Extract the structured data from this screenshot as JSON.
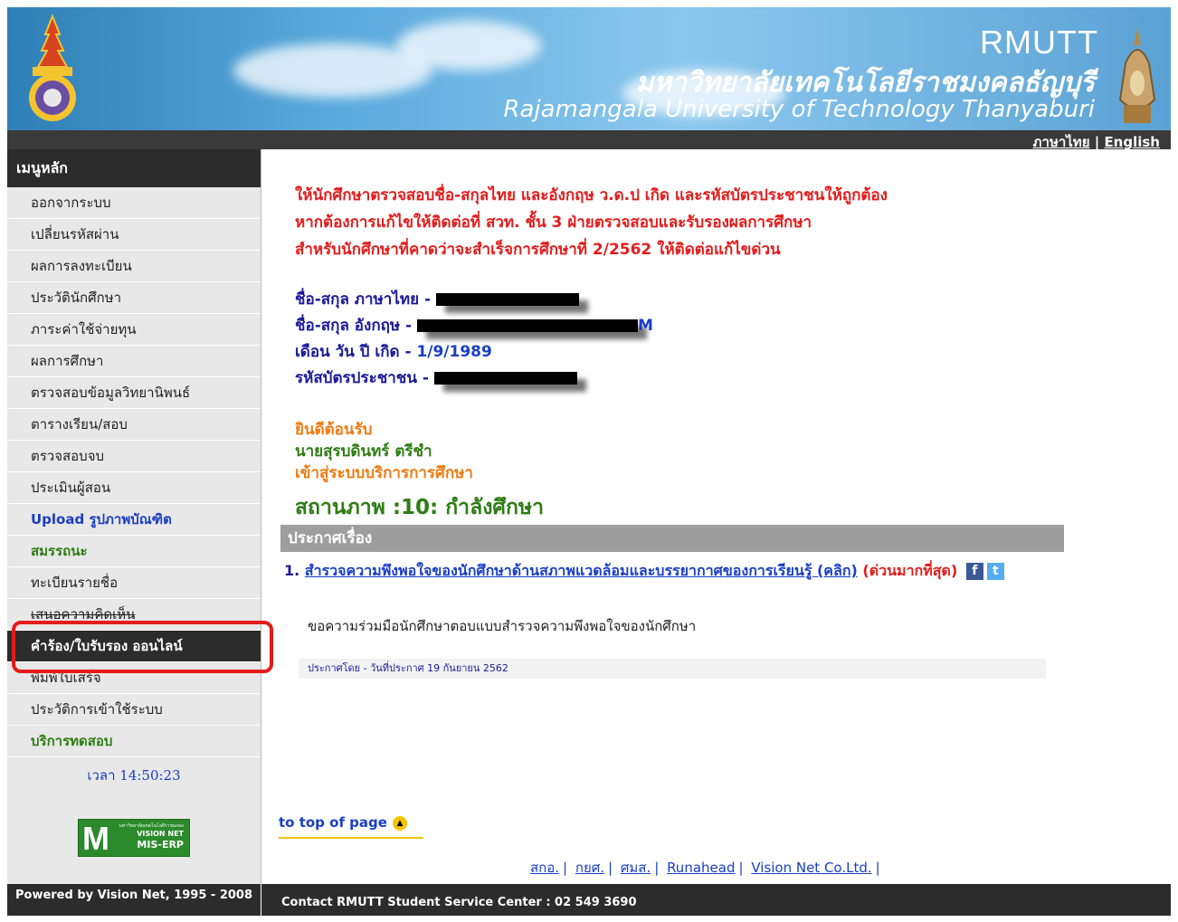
{
  "header": {
    "brand_abbr": "RMUTT",
    "brand_thai": "มหาวิทยาลัยเทคโนโลยีราชมงคลธัญบุรี",
    "brand_english": "Rajamangala University  of Technology Thanyaburi",
    "lang_thai": "ภาษาไทย",
    "lang_separator": "|",
    "lang_english": "English"
  },
  "sidebar": {
    "title": "เมนูหลัก",
    "items": [
      {
        "label": "ออกจากระบบ"
      },
      {
        "label": "เปลี่ยนรหัสผ่าน"
      },
      {
        "label": "ผลการลงทะเบียน"
      },
      {
        "label": "ประวัตินักศึกษา"
      },
      {
        "label": "ภาระค่าใช้จ่ายทุน"
      },
      {
        "label": "ผลการศึกษา"
      },
      {
        "label": "ตรวจสอบข้อมูลวิทยานิพนธ์"
      },
      {
        "label": "ตารางเรียน/สอบ"
      },
      {
        "label": "ตรวจสอบจบ"
      },
      {
        "label": "ประเมินผู้สอน"
      },
      {
        "label": "Upload รูปภาพบัณฑิต"
      },
      {
        "label": "สมรรถนะ"
      },
      {
        "label": "ทะเบียนรายชื่อ"
      },
      {
        "label": "เสนอความคิดเห็น"
      },
      {
        "label": "คำร้อง/ใบรับรอง ออนไลน์"
      },
      {
        "label": "พิมพ์ใบเสร็จ"
      },
      {
        "label": "ประวัติการเข้าใช้ระบบ"
      },
      {
        "label": "บริการทดสอบ"
      }
    ],
    "clock": "เวลา 14:50:23",
    "logo": {
      "small": "มหาวิทยาลัยเทคโนโลยีราชมงคล",
      "line1": "VISION NET",
      "line2": "MIS-ERP"
    },
    "footer": "Powered by Vision Net, 1995 - 2008"
  },
  "notice": {
    "line1": "ให้นักศึกษาตรวจสอบชื่อ-สกุลไทย และอังกฤษ ว.ด.ป เกิด และรหัสบัตรประชาชนให้ถูกต้อง",
    "line2": "หากต้องการแก้ไขให้ติดต่อที่ สวท. ชั้น 3 ฝ่ายตรวจสอบและรับรองผลการศึกษา",
    "line3": "สำหรับนักศึกษาที่คาดว่าจะสำเร็จการศึกษาที่ 2/2562 ให้ติดต่อแก้ไขด่วน"
  },
  "student": {
    "name_th_label": "ชื่อ-สกุล ภาษาไทย -",
    "name_en_label": "ชื่อ-สกุล อังกฤษ -",
    "name_en_tail": "M",
    "dob_label": "เดือน วัน ปี เกิด -",
    "dob_value": "1/9/1989",
    "id_label": "รหัสบัตรประชาชน -"
  },
  "welcome": {
    "greeting": "ยินดีต้อนรับ",
    "name": "นายสุรบดินทร์ ตรีชำ",
    "enter": "เข้าสู่ระบบบริการการศึกษา",
    "status": "สถานภาพ :10: กำลังศึกษา"
  },
  "announcement": {
    "header": "ประกาศเรื่อง",
    "number": "1.",
    "title": "สำรวจความพึงพอใจของนักศึกษาด้านสภาพแวดล้อมและบรรยากาศของการเรียนรู้ (คลิก)",
    "urgent": "(ด่วนมากที่สุด)",
    "description": "ขอความร่วมมือนักศึกษาตอบแบบสำรวจความพึงพอใจของนักศึกษา",
    "meta": "ประกาศโดย  -  วันที่ประกาศ  19 กันยายน 2562"
  },
  "footer": {
    "top_link": "to top of page",
    "links": [
      "สกอ.",
      "กยศ.",
      "ศมส.",
      "Runahead",
      "Vision Net Co.Ltd."
    ],
    "separator": "|",
    "contact": "Contact RMUTT Student Service Center : 02 549 3690"
  },
  "colors": {
    "header_blue": "#5aa9dc",
    "dark_bar": "#2c2c2c",
    "notice_red": "#e41b1b",
    "status_green": "#2e7d14",
    "link_blue": "#1a3ec8",
    "highlight_red": "#e41b1b"
  }
}
